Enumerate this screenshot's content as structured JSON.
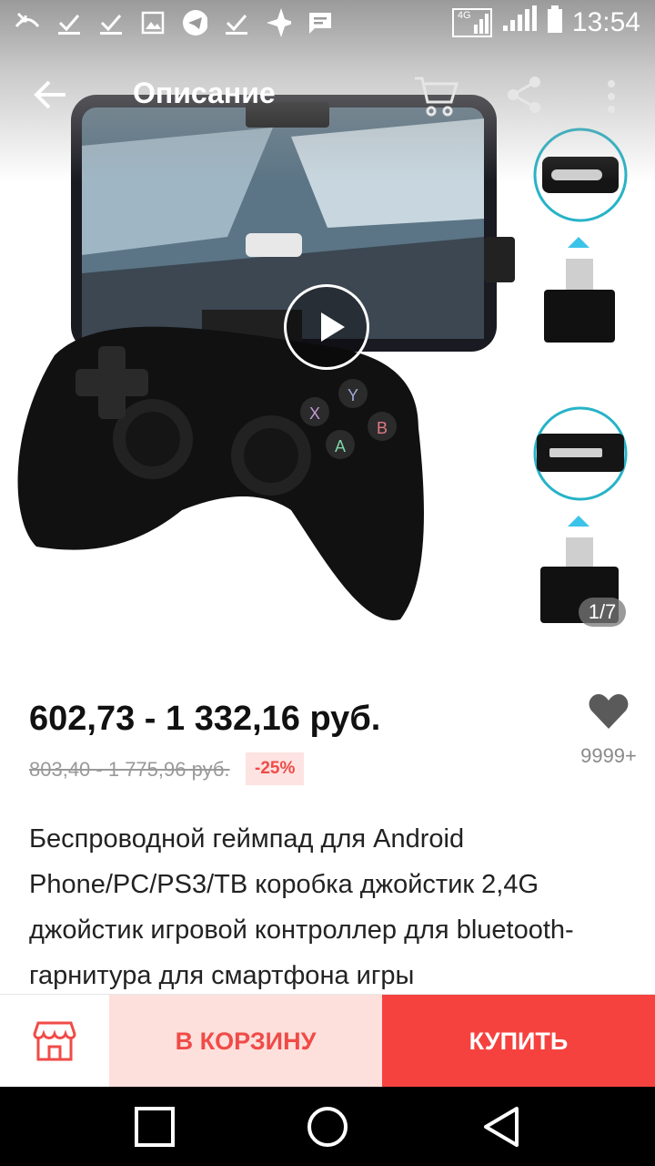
{
  "status_bar": {
    "time": "13:54",
    "network": "4G",
    "icons": [
      "missed-call-icon",
      "check-icon",
      "check-icon",
      "image-icon",
      "telegram-icon",
      "check-icon",
      "sparkle-icon",
      "message-icon"
    ]
  },
  "header": {
    "title": "Описание",
    "icons": [
      "back-arrow-icon",
      "cart-icon",
      "share-icon",
      "more-vert-icon"
    ]
  },
  "gallery": {
    "counter": "1/7",
    "has_video": true
  },
  "product": {
    "price": "602,73 - 1 332,16 руб.",
    "old_price": "803,40 - 1 775,96 руб.",
    "discount": "-25%",
    "favorites": "9999+",
    "description": "Беспроводной геймпад для Android Phone/PC/PS3/TB коробка джойстик 2,4G джойстик игровой контроллер для bluetooth-гарнитура для смартфона игры"
  },
  "actions": {
    "add_to_cart": "В КОРЗИНУ",
    "buy": "КУПИТЬ"
  },
  "colors": {
    "accent": "#f5423f",
    "accent_light": "#fde0dc",
    "discount_text": "#f04b48"
  }
}
